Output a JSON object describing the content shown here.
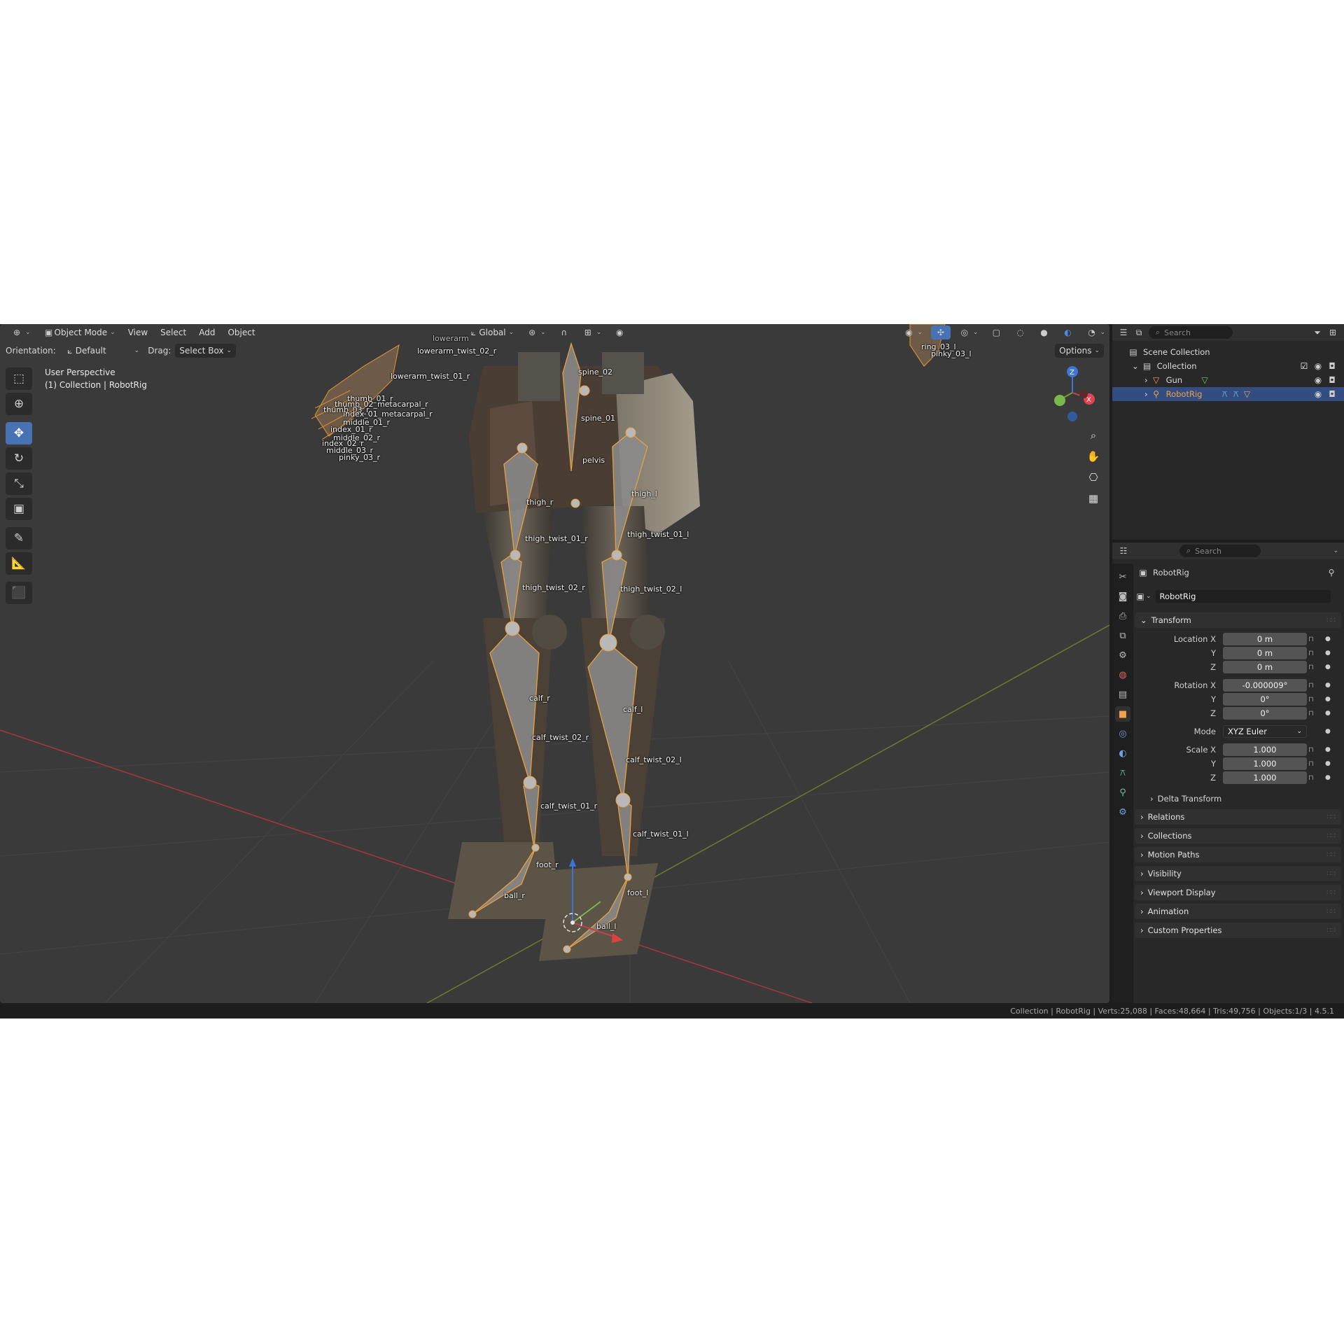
{
  "header": {
    "mode": "Object Mode",
    "menus": [
      "View",
      "Select",
      "Add",
      "Object"
    ],
    "orientation_global": "Global",
    "options": "Options"
  },
  "subheader": {
    "orientation_label": "Orientation:",
    "orientation_value": "Default",
    "drag_label": "Drag:",
    "drag_value": "Select Box"
  },
  "viewport": {
    "perspective": "User Perspective",
    "context": "(1) Collection | RobotRig",
    "bone_labels": [
      "lowerarm_twist_02_r",
      "lowerarm_twist_01_r",
      "thumb_01_r",
      "thumb_02_metacarpal_r",
      "thumb_03_r",
      "index_01_metacarpal_r",
      "index_01_r",
      "middle_01_r",
      "middle_02_r",
      "index_02_r",
      "middle_03_r",
      "pinky_03_r",
      "spine_02",
      "spine_01",
      "pelvis",
      "thigh_r",
      "thigh_l",
      "thigh_twist_01_r",
      "thigh_twist_01_l",
      "thigh_twist_02_r",
      "thigh_twist_02_l",
      "calf_r",
      "calf_l",
      "calf_twist_02_r",
      "calf_twist_02_l",
      "calf_twist_01_r",
      "calf_twist_01_l",
      "foot_r",
      "foot_l",
      "ball_r",
      "ball_l",
      "ring_03_l",
      "pinky_03_l",
      "lowerarm"
    ],
    "gizmo_axes": [
      "Z",
      "X"
    ]
  },
  "outliner": {
    "search_placeholder": "Search",
    "scene_collection": "Scene Collection",
    "collection": "Collection",
    "items": [
      "Gun",
      "RobotRig"
    ]
  },
  "properties": {
    "search_placeholder": "Search",
    "object_name": "RobotRig",
    "datablock_name": "RobotRig",
    "transform": {
      "title": "Transform",
      "location_label": "Location X",
      "rotation_label": "Rotation X",
      "mode_label": "Mode",
      "scale_label": "Scale X",
      "y_label": "Y",
      "z_label": "Z",
      "location": [
        "0 m",
        "0 m",
        "0 m"
      ],
      "rotation": [
        "-0.000009°",
        "0°",
        "0°"
      ],
      "mode": "XYZ Euler",
      "scale": [
        "1.000",
        "1.000",
        "1.000"
      ]
    },
    "delta_transform": "Delta Transform",
    "panels": [
      "Relations",
      "Collections",
      "Motion Paths",
      "Visibility",
      "Viewport Display",
      "Animation",
      "Custom Properties"
    ]
  },
  "status": "Collection | RobotRig | Verts:25,088 | Faces:48,664 | Tris:49,756 | Objects:1/3 | 4.5.1",
  "colors": {
    "accent": "#4772b3",
    "bone": "#e8a040",
    "x_axis": "#c0424a",
    "y_axis": "#7a9a2c",
    "z_axis": "#3b76d6"
  }
}
